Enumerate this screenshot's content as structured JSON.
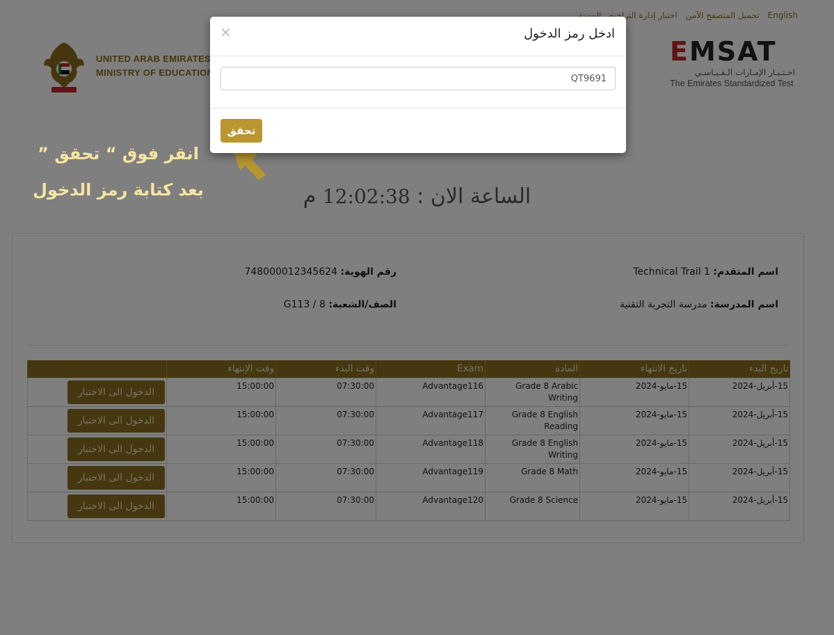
{
  "toplinks": [
    "English",
    "تحميل المتصفح الآمن",
    "اختبار إدارة التراخيص المهنية"
  ],
  "moe": {
    "line1": "UNITED ARAB EMIRATES",
    "line2": "MINISTRY OF EDUCATION"
  },
  "emsat": {
    "logo": "EMSAT",
    "arabic": "اخـتـبـار الإمـارات الـقـيـاسـي",
    "english": "The Emirates Standardized Test"
  },
  "clock": {
    "label": "الساعة الان :",
    "time": "12:02:38",
    "suffix": "م"
  },
  "student": {
    "name_label": "اسم المتقدم:",
    "name_value": "Technical Trail 1",
    "id_label": "رقم الهوية:",
    "id_value": "748000012345624",
    "school_label": "اسم المدرسة:",
    "school_value": "مدرسة التجربة التقنية",
    "grade_label": "الصف/الشعبة:",
    "grade_value": "G113 / 8"
  },
  "table": {
    "headers": [
      "تاريخ البدء",
      "تاريخ الانتهاء",
      "المادة",
      "Exam",
      "وقت البدء",
      "وقت الإنتهاء",
      ""
    ],
    "rows": [
      {
        "start_date": "15-أبريل-2024",
        "end_date": "15-مايو-2024",
        "subject": "Grade 8 Arabic Writing",
        "exam": "Advantage116",
        "start_time": "07:30:00",
        "end_time": "15:00:00",
        "button": "الدخول الى الاختبار"
      },
      {
        "start_date": "15-أبريل-2024",
        "end_date": "15-مايو-2024",
        "subject": "Grade 8 English Reading",
        "exam": "Advantage117",
        "start_time": "07:30:00",
        "end_time": "15:00:00",
        "button": "الدخول الى الاختبار"
      },
      {
        "start_date": "15-أبريل-2024",
        "end_date": "15-مايو-2024",
        "subject": "Grade 8 English Writing",
        "exam": "Advantage118",
        "start_time": "07:30:00",
        "end_time": "15:00:00",
        "button": "الدخول الى الاختبار"
      },
      {
        "start_date": "15-أبريل-2024",
        "end_date": "15-مايو-2024",
        "subject": "Grade 8 Math",
        "exam": "Advantage119",
        "start_time": "07:30:00",
        "end_time": "15:00:00",
        "button": "الدخول الى الاختبار"
      },
      {
        "start_date": "15-أبريل-2024",
        "end_date": "15-مايو-2024",
        "subject": "Grade 8 Science",
        "exam": "Advantage120",
        "start_time": "07:30:00",
        "end_time": "15:00:00",
        "button": "الدخول الى الاختبار"
      }
    ]
  },
  "modal": {
    "title": "ادخل رمز الدخول",
    "close": "×",
    "code_value": "QT9691",
    "verify_label": "تحقق"
  },
  "annotation": {
    "line1": "انقر فوق “ تحقق ”",
    "line2": "بعد كتابة رمز الدخول"
  },
  "colors": {
    "gold": "#8a6e1f",
    "button_gold": "#bb9630",
    "annotation": "#f6e5a2"
  }
}
